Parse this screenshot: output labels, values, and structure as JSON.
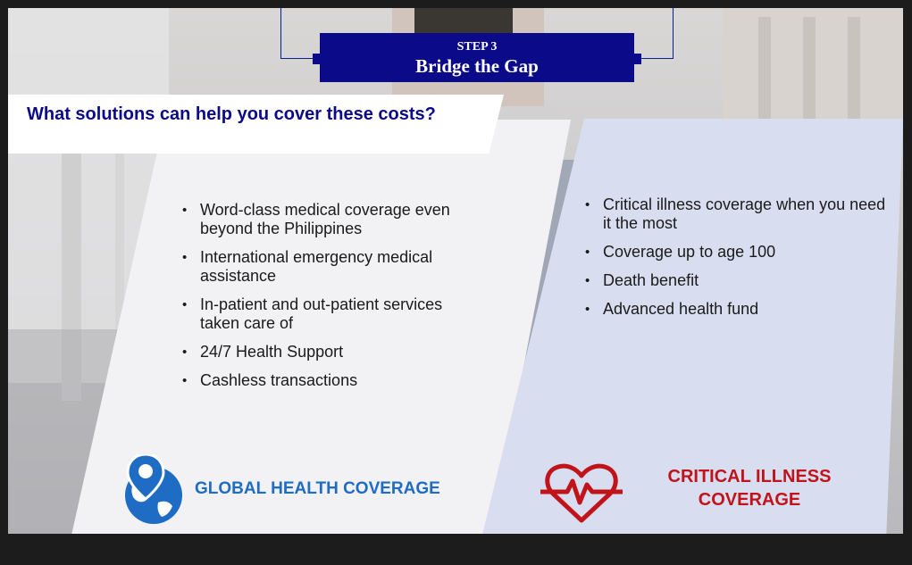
{
  "step": {
    "label": "STEP 3",
    "title": "Bridge the Gap"
  },
  "question": "What solutions can help you cover these costs?",
  "left_panel": {
    "bullets": [
      "Word-class medical coverage even beyond the Philippines",
      "International emergency medical assistance",
      "In-patient and out-patient services taken care of",
      "24/7 Health Support",
      "Cashless transactions"
    ],
    "label": "GLOBAL HEALTH COVERAGE",
    "icon": "globe-pin-icon",
    "color": "#1f6cc4"
  },
  "right_panel": {
    "bullets": [
      "Critical illness coverage when you need it the most",
      "Coverage up to age 100",
      "Death benefit",
      "Advanced health fund"
    ],
    "label_line1": "CRITICAL ILLNESS",
    "label_line2": "COVERAGE",
    "icon": "heartbeat-icon",
    "color": "#c0131a"
  },
  "colors": {
    "brand_navy": "#0b0b8a"
  }
}
